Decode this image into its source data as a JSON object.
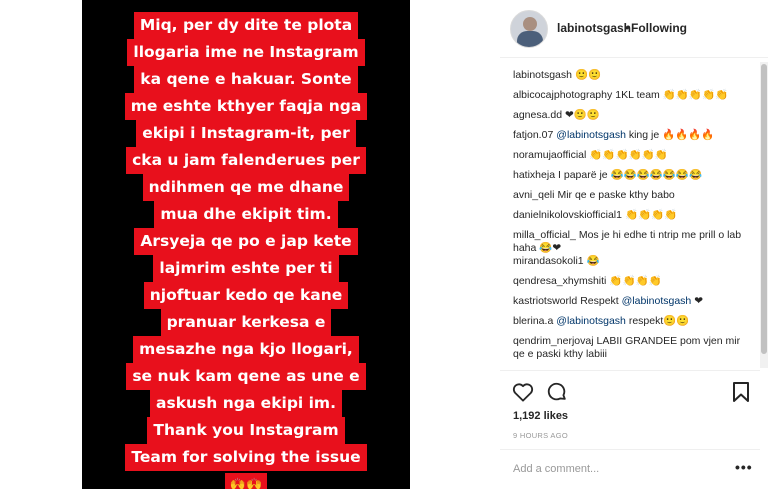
{
  "post": {
    "story_lines": [
      "Miq, per dy dite te plota",
      "llogaria ime ne Instagram",
      "ka qene e hakuar. Sonte",
      "me eshte kthyer faqja nga",
      "ekipi i Instagram-it, per",
      "cka u jam falenderues per",
      "ndihmen qe me dhane",
      "mua dhe ekipit tim.",
      "Arsyeja qe po e jap kete",
      "lajmrim eshte per ti",
      "njoftuar kedo qe kane",
      "pranuar kerkesa e",
      "mesazhe nga kjo llogari,",
      "se nuk kam qene as une e",
      "askush nga ekipi im.",
      "Thank you Instagram",
      "Team for solving the issue"
    ],
    "story_emoji": "🙌🙌"
  },
  "header": {
    "username": "labinotsgash",
    "separator": "•",
    "follow_status": "Following",
    "avatar_icon": "profile-avatar"
  },
  "comments": [
    {
      "user": "labinotsgash",
      "text": "🙂🙂"
    },
    {
      "user": "albicocajphotography",
      "text": "1KL team 👏👏👏👏👏"
    },
    {
      "user": "agnesa.dd",
      "text": "❤🙂🙂"
    },
    {
      "user": "fatjon.07",
      "mention": "@labinotsgash",
      "text": "king je 🔥🔥🔥🔥"
    },
    {
      "user": "noramujaofficial",
      "text": "👏👏👏👏👏👏"
    },
    {
      "user": "hatixheja",
      "text": "I paparë je 😂😂😂😂😂😂😂"
    },
    {
      "user": "avni_qeli",
      "text": "Mir qe e paske kthy babo"
    },
    {
      "user": "danielnikolovskiofficial1",
      "text": "👏👏👏👏"
    },
    {
      "user": "milla_official_",
      "text": "Mos je hi edhe ti ntrip me prill o lab haha 😂❤"
    },
    {
      "user": "mirandasokoli1",
      "text": "😂"
    },
    {
      "user": "qendresa_xhymshiti",
      "text": "👏👏👏👏"
    },
    {
      "user": "kastriotsworld",
      "text": "Respekt",
      "mention": "@labinotsgash",
      "suffix": "❤"
    },
    {
      "user": "blerina.a",
      "mention": "@labinotsgash",
      "text": "respekt🙂🙂"
    },
    {
      "user": "qendrim_nerjovaj",
      "text": "LABII GRANDEE pom vjen mir qe e paski kthy labiii"
    }
  ],
  "actions": {
    "like_icon": "heart-icon",
    "comment_icon": "comment-icon",
    "save_icon": "bookmark-icon"
  },
  "likes": "1,192 likes",
  "timestamp": "9 HOURS AGO",
  "add_comment_placeholder": "Add a comment...",
  "more_label": "•••",
  "colors": {
    "story_highlight": "#e8101c",
    "mention": "#003569",
    "muted": "#999999"
  }
}
